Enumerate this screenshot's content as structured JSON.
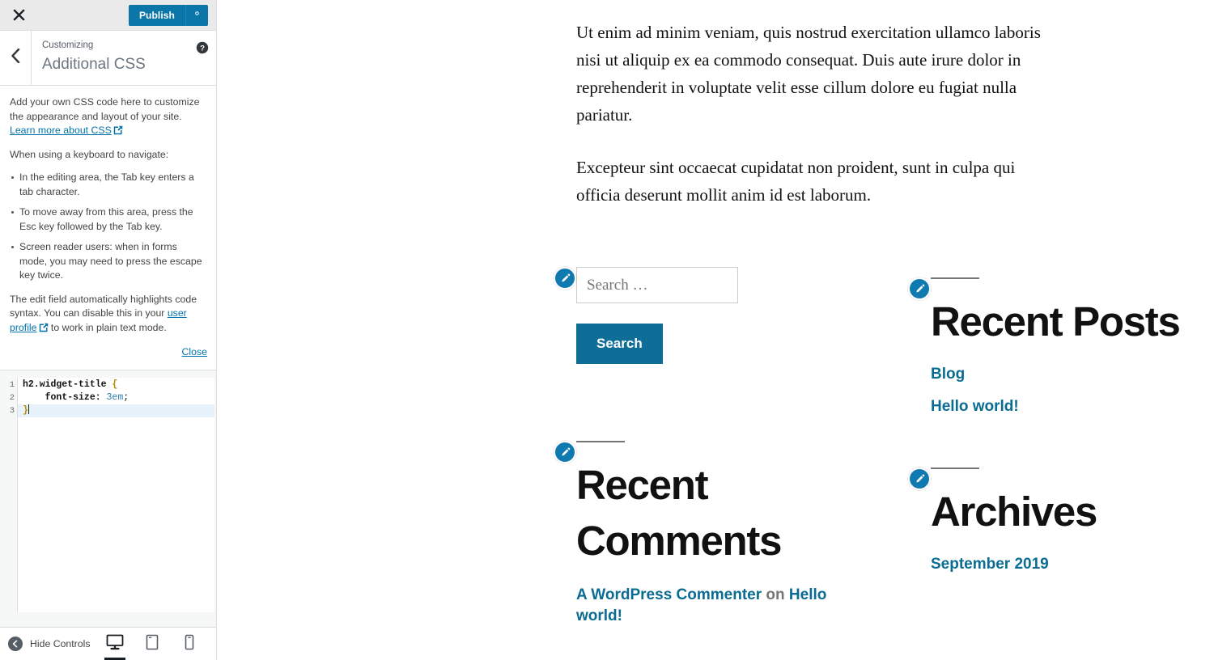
{
  "customizer": {
    "topbar": {
      "close_icon": "close-icon",
      "publish_label": "Publish",
      "gear_icon": "gear-icon"
    },
    "header": {
      "back_icon": "chevron-left-icon",
      "kicker": "Customizing",
      "title": "Additional CSS",
      "help_icon": "help-icon"
    },
    "description": {
      "intro": "Add your own CSS code here to customize the appearance and layout of your site.",
      "learn_more_link": "Learn more about CSS",
      "keyboard_heading": "When using a keyboard to navigate:",
      "bullets": [
        "In the editing area, the Tab key enters a tab character.",
        "To move away from this area, press the Esc key followed by the Tab key.",
        "Screen reader users: when in forms mode, you may need to press the escape key twice."
      ],
      "highlight_note_before": "The edit field automatically highlights code syntax. You can disable this in your ",
      "profile_link": "user profile",
      "highlight_note_after": " to work in plain text mode.",
      "close_label": "Close"
    },
    "editor": {
      "line_numbers": [
        "1",
        "2",
        "3"
      ],
      "lines": [
        {
          "selector": "h2.widget-title",
          "brace": "{"
        },
        {
          "property": "font-size:",
          "value": "3em",
          "semicolon": ";"
        },
        {
          "brace": "}"
        }
      ],
      "raw_css": "h2.widget-title {\n    font-size: 3em;\n}"
    },
    "footer": {
      "collapse_label": "Hide Controls",
      "collapse_icon": "collapse-arrow-icon",
      "devices": [
        {
          "name": "desktop",
          "icon": "desktop-icon",
          "active": true
        },
        {
          "name": "tablet",
          "icon": "tablet-icon",
          "active": false
        },
        {
          "name": "mobile",
          "icon": "mobile-icon",
          "active": false
        }
      ]
    }
  },
  "preview": {
    "paragraphs": [
      "Ut enim ad minim veniam, quis nostrud exercitation ullamco laboris nisi ut aliquip ex ea commodo consequat. Duis aute irure dolor in reprehenderit in voluptate velit esse cillum dolore eu fugiat nulla pariatur.",
      "Excepteur sint occaecat cupidatat non proident, sunt in culpa qui officia deserunt mollit anim id est laborum."
    ],
    "search_widget": {
      "edit_icon": "edit-pencil-icon",
      "input_placeholder": "Search …",
      "input_value": "",
      "button_label": "Search"
    },
    "recent_posts": {
      "edit_icon": "edit-pencil-icon",
      "title": "Recent Posts",
      "items": [
        "Blog",
        "Hello world!"
      ]
    },
    "recent_comments": {
      "edit_icon": "edit-pencil-icon",
      "title": "Recent Comments",
      "comment_author": "A WordPress Commenter",
      "comment_on": " on ",
      "comment_post": "Hello world!"
    },
    "archives": {
      "edit_icon": "edit-pencil-icon",
      "title": "Archives",
      "items": [
        "September 2019"
      ]
    }
  },
  "colors": {
    "accent_blue": "#0b76a8",
    "link_blue": "#0a6c92",
    "pencil_blue": "#0f7ab0",
    "sidebar_bg": "#ffffff",
    "topbar_bg": "#eaeaea",
    "editor_bg": "#f6f7f7",
    "active_line": "#e8f2fb"
  }
}
